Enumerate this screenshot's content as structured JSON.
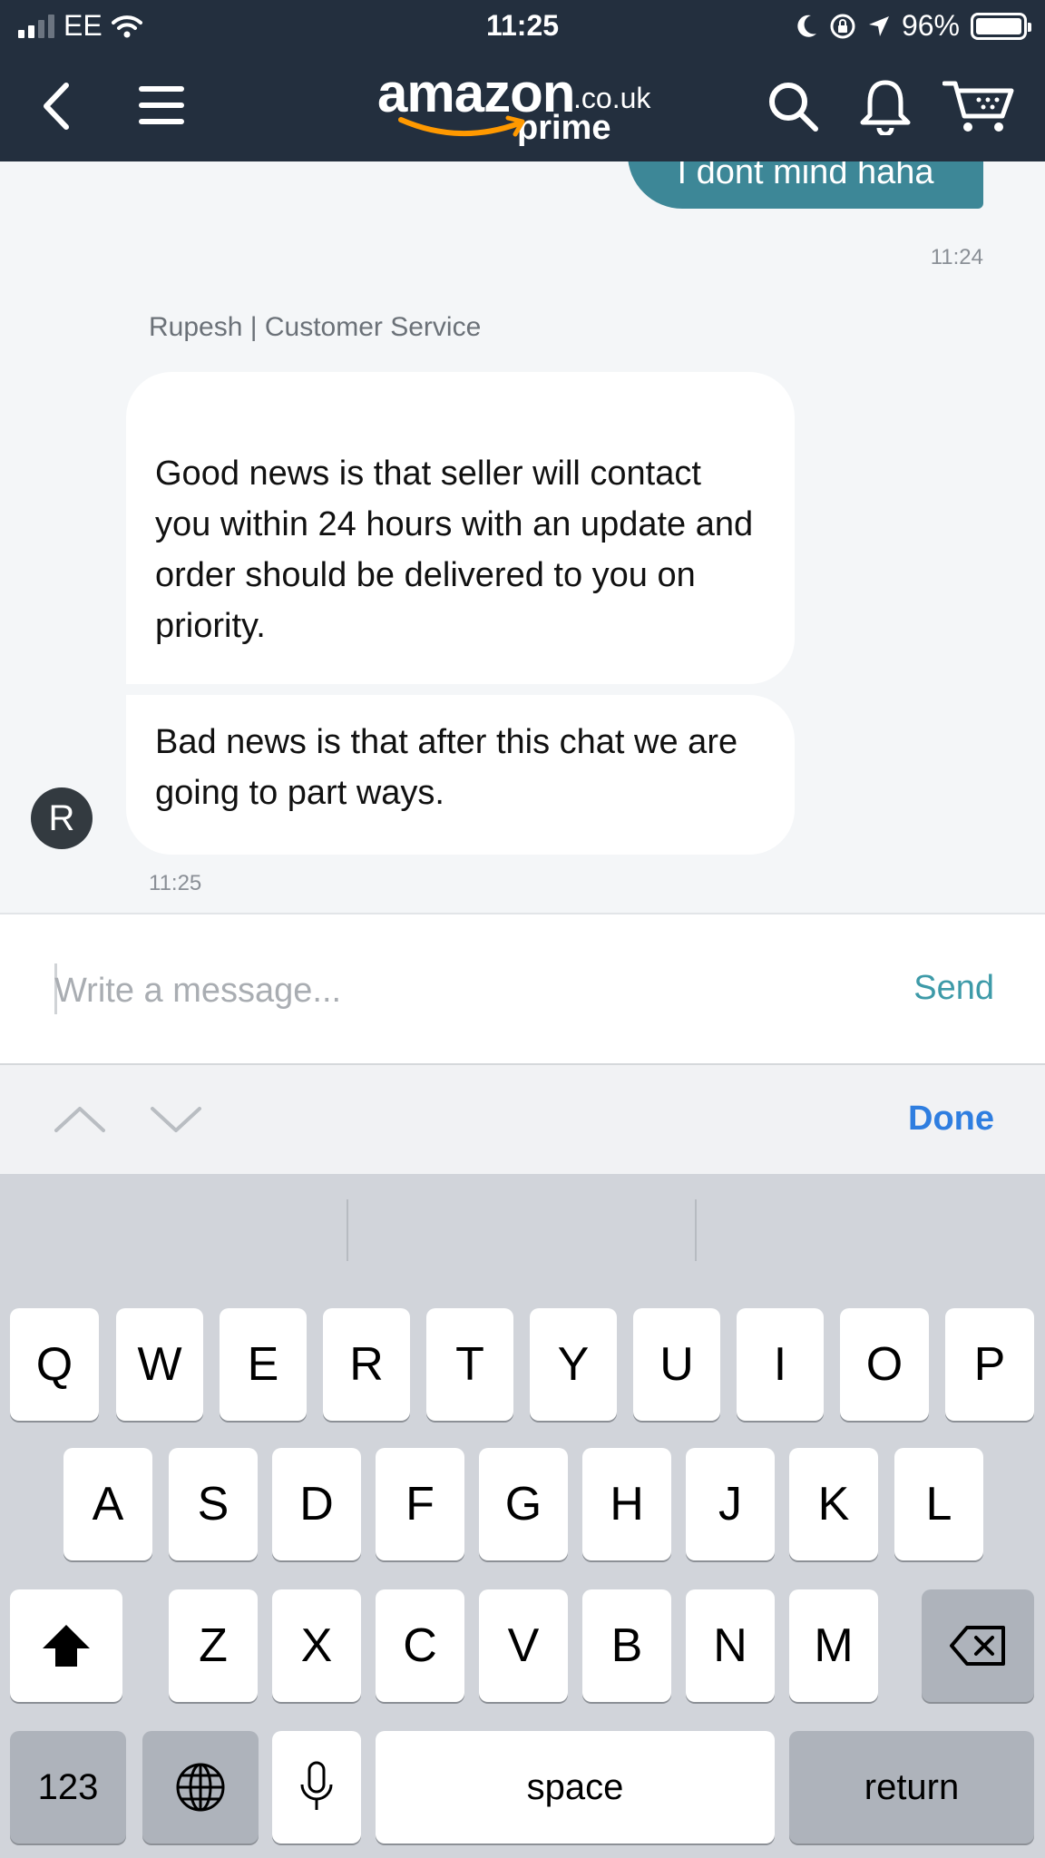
{
  "status_bar": {
    "carrier": "EE",
    "time": "11:25",
    "battery": "96%"
  },
  "nav": {
    "logo_main": "amazon",
    "logo_domain": ".co.uk",
    "logo_sub": "prime"
  },
  "chat": {
    "user_message": "I dont mind haha",
    "user_timestamp": "11:24",
    "agent_name": "Rupesh | Customer Service",
    "agent_messages": [
      "Good news is that seller will contact you within 24 hours with an update and order should be delivered to you on priority.",
      "Bad news is that after this chat we are going to part ways."
    ],
    "agent_avatar_letter": "R",
    "agent_timestamp": "11:25"
  },
  "composer": {
    "placeholder": "Write a message...",
    "send_label": "Send"
  },
  "accessory": {
    "done_label": "Done"
  },
  "keyboard": {
    "row1": [
      "Q",
      "W",
      "E",
      "R",
      "T",
      "Y",
      "U",
      "I",
      "O",
      "P"
    ],
    "row2": [
      "A",
      "S",
      "D",
      "F",
      "G",
      "H",
      "J",
      "K",
      "L"
    ],
    "row3": [
      "Z",
      "X",
      "C",
      "V",
      "B",
      "N",
      "M"
    ],
    "numbers_label": "123",
    "space_label": "space",
    "return_label": "return"
  },
  "colors": {
    "header": "#232f3e",
    "user_bubble": "#3d8797",
    "send": "#3d9aa8",
    "done": "#2f7ee0",
    "logo_smile": "#f90"
  },
  "icons": [
    "back-chevron-icon",
    "menu-icon",
    "search-icon",
    "bell-icon",
    "cart-icon",
    "wifi-icon",
    "moon-icon",
    "rotation-lock-icon",
    "location-icon",
    "shift-icon",
    "backspace-icon",
    "globe-icon",
    "microphone-icon"
  ]
}
